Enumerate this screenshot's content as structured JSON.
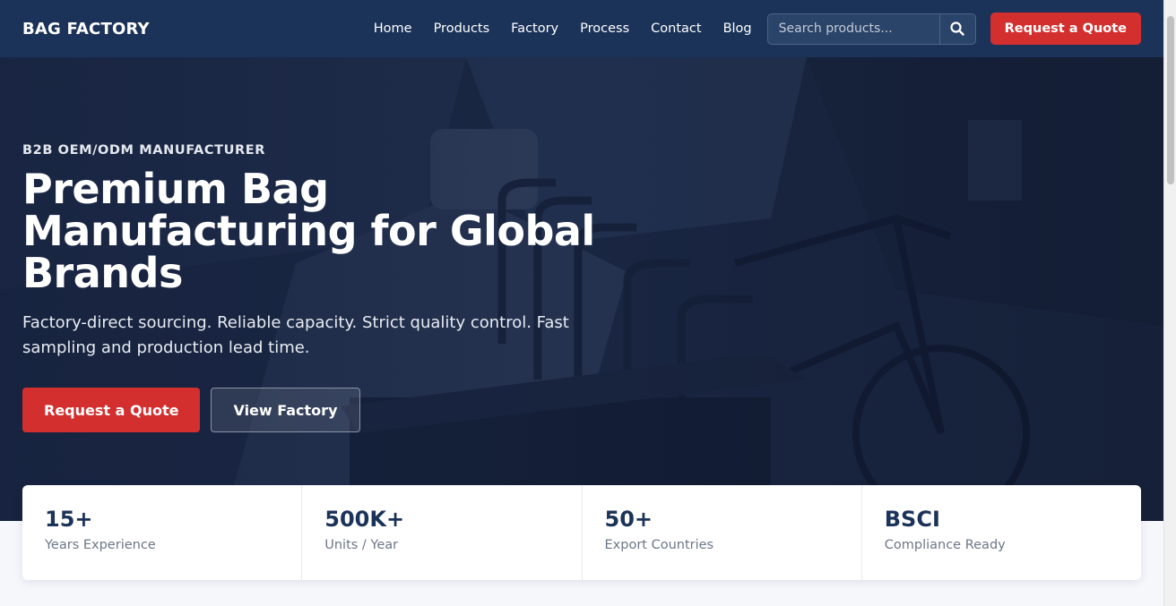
{
  "header": {
    "brand": "BAG FACTORY",
    "nav": [
      "Home",
      "Products",
      "Factory",
      "Process",
      "Contact",
      "Blog"
    ],
    "search_placeholder": "Search products...",
    "search_icon": "search-icon",
    "quote_label": "Request a Quote"
  },
  "hero": {
    "eyebrow": "B2B OEM/ODM MANUFACTURER",
    "title": "Premium Bag Manufacturing for Global Brands",
    "subtitle": "Factory-direct sourcing. Reliable capacity. Strict quality control. Fast sampling and production lead time.",
    "primary_cta": "Request a Quote",
    "secondary_cta": "View Factory"
  },
  "stats": [
    {
      "value": "15+",
      "label": "Years Experience"
    },
    {
      "value": "500K+",
      "label": "Units / Year"
    },
    {
      "value": "50+",
      "label": "Export Countries"
    },
    {
      "value": "BSCI",
      "label": "Compliance Ready"
    }
  ],
  "colors": {
    "header_bg": "#1b3359",
    "accent": "#d32f2f",
    "stat_value": "#1b3359"
  }
}
